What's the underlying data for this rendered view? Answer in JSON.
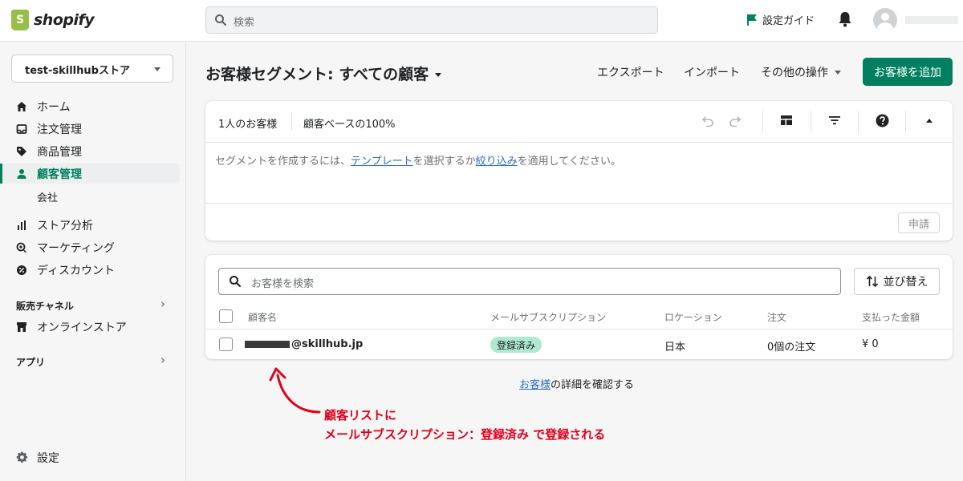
{
  "topbar": {
    "logo_text": "shopify",
    "search_placeholder": "検索",
    "setup_guide": "設定ガイド"
  },
  "sidebar": {
    "store_name": "test-skillhubストア",
    "items": [
      {
        "label": "ホーム",
        "icon": "home-icon"
      },
      {
        "label": "注文管理",
        "icon": "inbox-icon"
      },
      {
        "label": "商品管理",
        "icon": "tag-icon"
      },
      {
        "label": "顧客管理",
        "icon": "person-icon",
        "active": true
      }
    ],
    "sub_item": "会社",
    "items2": [
      {
        "label": "ストア分析",
        "icon": "bar-chart-icon"
      },
      {
        "label": "マーケティング",
        "icon": "target-icon"
      },
      {
        "label": "ディスカウント",
        "icon": "discount-icon"
      }
    ],
    "sales_channels_label": "販売チャネル",
    "online_store": "オンラインストア",
    "apps_label": "アプリ",
    "settings": "設定"
  },
  "header": {
    "title": "お客様セグメント: すべての顧客",
    "export": "エクスポート",
    "import": "インポート",
    "more_actions": "その他の操作",
    "add_customer": "お客様を追加"
  },
  "segment_card": {
    "customer_count": "1人のお客様",
    "base_percent": "顧客ベースの100%",
    "body_prefix": "セグメントを作成するには、",
    "template_link": "テンプレート",
    "body_mid": "を選択するか",
    "filter_link": "絞り込み",
    "body_suffix": "を適用してください。",
    "apply": "申請"
  },
  "customer_table": {
    "search_placeholder": "お客様を検索",
    "sort_label": "並び替え",
    "columns": [
      "顧客名",
      "メールサブスクリプション",
      "ロケーション",
      "注文",
      "支払った金額"
    ],
    "rows": [
      {
        "name_suffix": "@skillhub.jp",
        "subscription": "登録済み",
        "location": "日本",
        "orders": "0個の注文",
        "spent": "¥ 0"
      }
    ]
  },
  "footer": {
    "link": "お客様",
    "suffix": "の詳細を確認する"
  },
  "annotation": {
    "line1": "顧客リストに",
    "line2": "メールサブスクリプション：登録済み で登録される"
  },
  "colors": {
    "primary": "#008060",
    "badge": "#aee9d1",
    "annotation": "#e2001a",
    "link": "#2c6ecb"
  }
}
